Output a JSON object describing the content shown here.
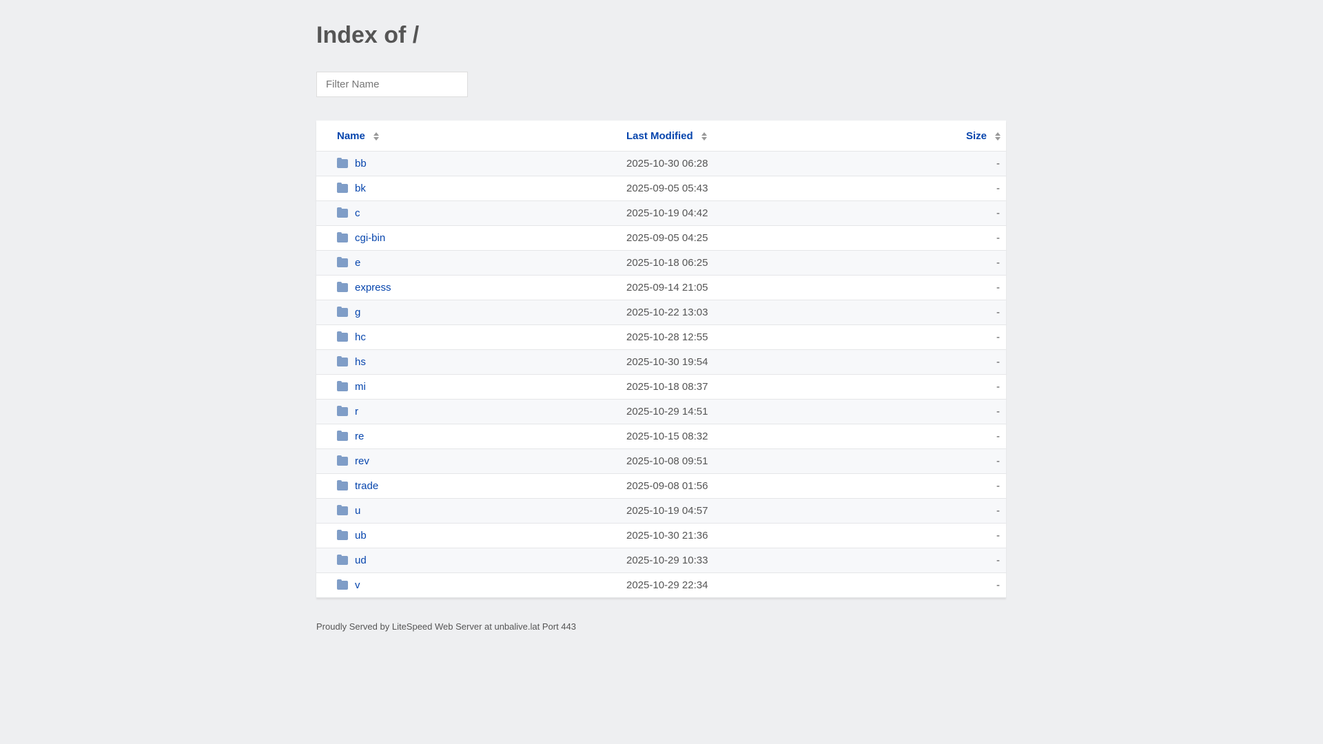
{
  "title": "Index of /",
  "filter": {
    "placeholder": "Filter Name",
    "value": ""
  },
  "columns": {
    "name": "Name",
    "modified": "Last Modified",
    "size": "Size"
  },
  "rows": [
    {
      "name": "bb",
      "modified": "2025-10-30 06:28",
      "size": "-"
    },
    {
      "name": "bk",
      "modified": "2025-09-05 05:43",
      "size": "-"
    },
    {
      "name": "c",
      "modified": "2025-10-19 04:42",
      "size": "-"
    },
    {
      "name": "cgi-bin",
      "modified": "2025-09-05 04:25",
      "size": "-"
    },
    {
      "name": "e",
      "modified": "2025-10-18 06:25",
      "size": "-"
    },
    {
      "name": "express",
      "modified": "2025-09-14 21:05",
      "size": "-"
    },
    {
      "name": "g",
      "modified": "2025-10-22 13:03",
      "size": "-"
    },
    {
      "name": "hc",
      "modified": "2025-10-28 12:55",
      "size": "-"
    },
    {
      "name": "hs",
      "modified": "2025-10-30 19:54",
      "size": "-"
    },
    {
      "name": "mi",
      "modified": "2025-10-18 08:37",
      "size": "-"
    },
    {
      "name": "r",
      "modified": "2025-10-29 14:51",
      "size": "-"
    },
    {
      "name": "re",
      "modified": "2025-10-15 08:32",
      "size": "-"
    },
    {
      "name": "rev",
      "modified": "2025-10-08 09:51",
      "size": "-"
    },
    {
      "name": "trade",
      "modified": "2025-09-08 01:56",
      "size": "-"
    },
    {
      "name": "u",
      "modified": "2025-10-19 04:57",
      "size": "-"
    },
    {
      "name": "ub",
      "modified": "2025-10-30 21:36",
      "size": "-"
    },
    {
      "name": "ud",
      "modified": "2025-10-29 10:33",
      "size": "-"
    },
    {
      "name": "v",
      "modified": "2025-10-29 22:34",
      "size": "-"
    }
  ],
  "footer": "Proudly Served by LiteSpeed Web Server at unbalive.lat Port 443"
}
